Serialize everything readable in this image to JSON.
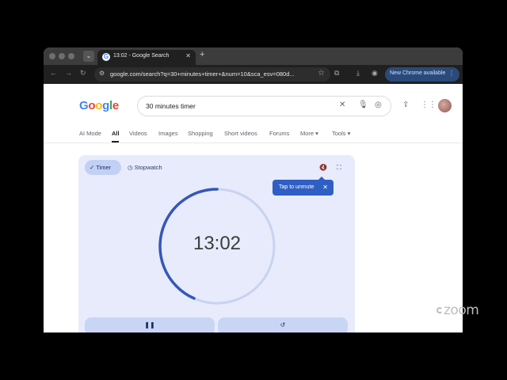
{
  "browser": {
    "tab_title": "13:02 - Google Search",
    "tab_favicon": "G",
    "url": "google.com/search?q=30+minutes+timer+&num=10&sca_esv=080d...",
    "update_label": "New Chrome available",
    "icons": [
      "back-icon",
      "forward-icon",
      "reload-icon",
      "site-info-icon",
      "star-icon",
      "extensions-icon",
      "download-icon",
      "profile-icon",
      "menu-dots-icon"
    ]
  },
  "google": {
    "logo": [
      "G",
      "o",
      "o",
      "g",
      "l",
      "e"
    ],
    "logo_colors": [
      "#4285f4",
      "#ea4335",
      "#fbbc05",
      "#4285f4",
      "#34a853",
      "#ea4335"
    ],
    "query": "30 minutes timer",
    "tabs": [
      {
        "label": "AI Mode"
      },
      {
        "label": "All",
        "active": true
      },
      {
        "label": "Videos"
      },
      {
        "label": "Images"
      },
      {
        "label": "Shopping"
      },
      {
        "label": "Short videos"
      },
      {
        "label": "Forums"
      },
      {
        "label": "More ▾"
      },
      {
        "label": "Tools ▾"
      }
    ]
  },
  "timer": {
    "mode_timer": "Timer",
    "mode_stopwatch": "Stopwatch",
    "tooltip": "Tap to unmute",
    "time": "13:02",
    "progress_remaining": 0.434,
    "colors": {
      "ring": "#3557b8",
      "track": "#c8d3f0",
      "card": "#e7ebfb"
    }
  },
  "watermark": "zoom"
}
